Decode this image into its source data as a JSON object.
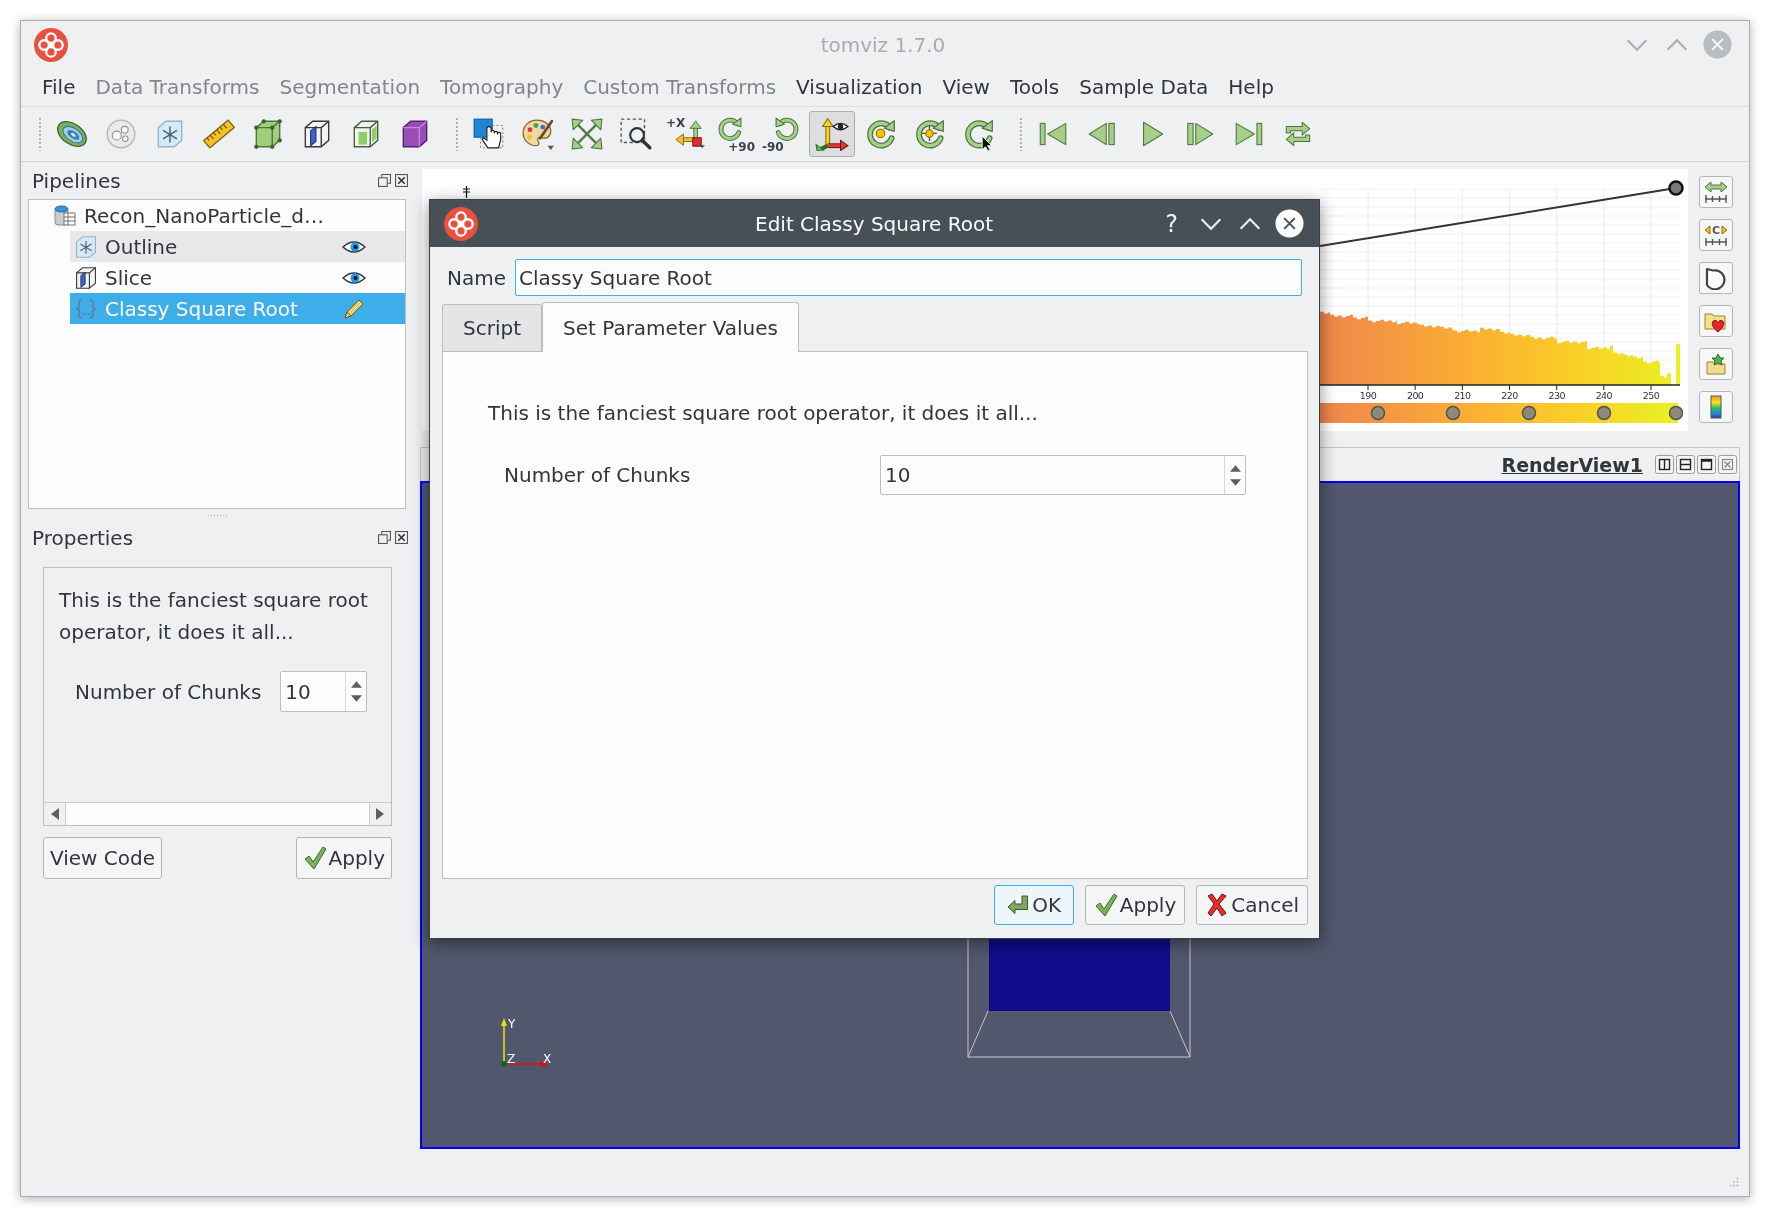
{
  "window": {
    "title": "tomviz 1.7.0",
    "active": false
  },
  "menu": [
    {
      "label": "File",
      "disabled": false
    },
    {
      "label": "Data Transforms",
      "disabled": true
    },
    {
      "label": "Segmentation",
      "disabled": true
    },
    {
      "label": "Tomography",
      "disabled": true
    },
    {
      "label": "Custom Transforms",
      "disabled": true
    },
    {
      "label": "Visualization",
      "disabled": false
    },
    {
      "label": "View",
      "disabled": false
    },
    {
      "label": "Tools",
      "disabled": false
    },
    {
      "label": "Sample Data",
      "disabled": false
    },
    {
      "label": "Help",
      "disabled": false
    }
  ],
  "toolbar": {
    "groups": [
      [
        {
          "kind": "contour",
          "active": false
        },
        {
          "kind": "spheres",
          "active": false
        },
        {
          "kind": "outline",
          "active": false
        },
        {
          "kind": "ruler",
          "active": false
        },
        {
          "kind": "threshold",
          "active": false
        },
        {
          "kind": "slice",
          "active": false
        },
        {
          "kind": "clip",
          "active": false
        },
        {
          "kind": "volume",
          "active": false
        }
      ],
      [
        {
          "kind": "pick",
          "active": false
        },
        {
          "kind": "palette",
          "active": false
        },
        {
          "kind": "reset",
          "active": false
        },
        {
          "kind": "zoombox",
          "active": false
        },
        {
          "kind": "axis",
          "caption": "+X",
          "active": false
        },
        {
          "kind": "rotatecw",
          "caption": "+90",
          "active": false
        },
        {
          "kind": "rotateccw",
          "caption": "-90",
          "active": false
        },
        {
          "kind": "axes",
          "active": true
        },
        {
          "kind": "orbit",
          "active": false
        },
        {
          "kind": "center",
          "active": false
        },
        {
          "kind": "pickcenter",
          "active": false
        }
      ],
      [
        {
          "kind": "first",
          "active": false
        },
        {
          "kind": "previous",
          "active": false
        },
        {
          "kind": "play",
          "active": false
        },
        {
          "kind": "next",
          "active": false
        },
        {
          "kind": "last",
          "active": false
        },
        {
          "kind": "loop",
          "active": false
        }
      ]
    ]
  },
  "pipelines": {
    "title": "Pipelines",
    "items": [
      {
        "label": "Recon_NanoParticle_d…",
        "kind": "dataset",
        "selected": false,
        "hovered": false,
        "children": [
          {
            "label": "Outline",
            "kind": "outline",
            "visible": true,
            "selected": false,
            "hovered": true
          },
          {
            "label": "Slice",
            "kind": "slice",
            "visible": true,
            "selected": false,
            "hovered": false
          },
          {
            "label": "Classy Square Root",
            "kind": "operator",
            "selected": true,
            "hovered": false
          }
        ]
      }
    ]
  },
  "properties": {
    "title": "Properties",
    "description": "This is the fanciest square root operator, it does it all...",
    "parameters": [
      {
        "label": "Number of Chunks",
        "value": "10"
      }
    ],
    "buttons": [
      {
        "label": "View Code",
        "kind": "plain"
      },
      {
        "label": "Apply",
        "kind": "apply"
      }
    ]
  },
  "color_map_editor": {
    "ticks": [
      "190",
      "200",
      "210",
      "220",
      "230",
      "240",
      "250"
    ],
    "buttons": [
      {
        "kind": "fitrange"
      },
      {
        "kind": "customrange",
        "caption": "C"
      },
      {
        "kind": "opacity"
      },
      {
        "kind": "presets"
      },
      {
        "kind": "save"
      },
      {
        "kind": "colorbar"
      }
    ]
  },
  "render_view": {
    "title": "RenderView1",
    "active": true,
    "axis_labels": {
      "y": "Y",
      "z": "Z",
      "x": "X"
    }
  },
  "dialog": {
    "title": "Edit Classy Square Root",
    "help": "?",
    "name_label": "Name",
    "name_value": "Classy Square Root",
    "tabs": [
      {
        "label": "Script",
        "selected": false
      },
      {
        "label": "Set Parameter Values",
        "selected": true
      }
    ],
    "description": "This is the fanciest square root operator, it does it all...",
    "parameters": [
      {
        "label": "Number of Chunks",
        "value": "10"
      }
    ],
    "buttons": [
      {
        "label": "OK",
        "kind": "ok",
        "default": true
      },
      {
        "label": "Apply",
        "kind": "apply",
        "default": false
      },
      {
        "label": "Cancel",
        "kind": "cancel",
        "default": false
      }
    ]
  }
}
